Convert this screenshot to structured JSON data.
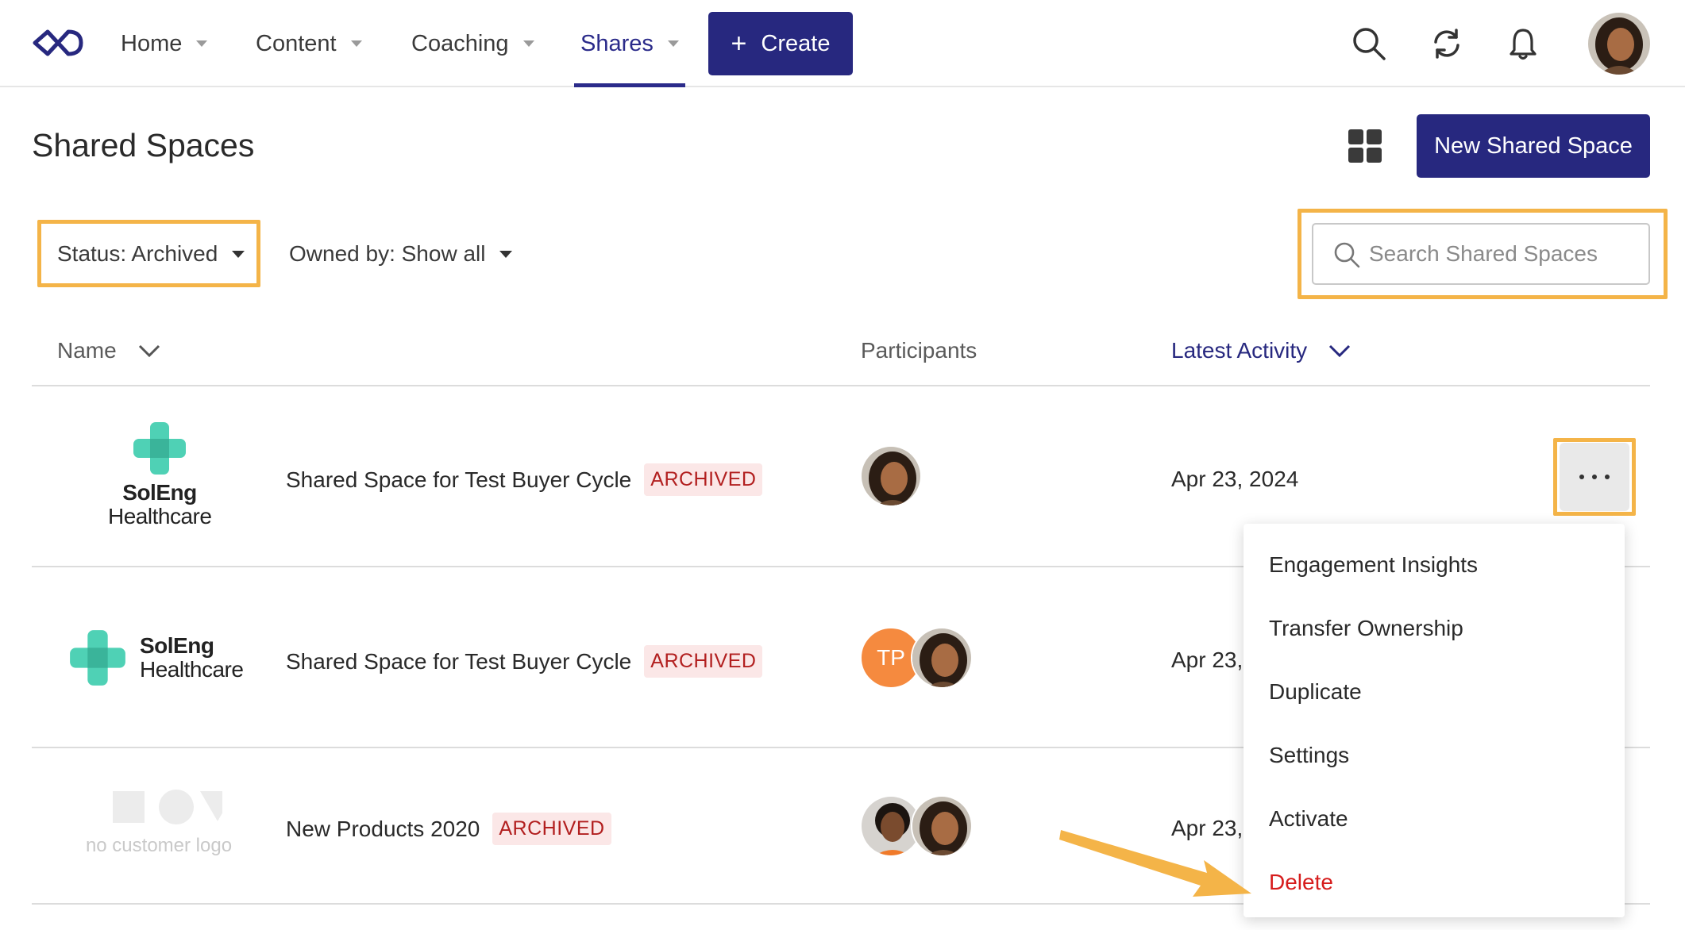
{
  "nav": {
    "items": [
      {
        "label": "Home"
      },
      {
        "label": "Content"
      },
      {
        "label": "Coaching"
      },
      {
        "label": "Shares"
      }
    ],
    "active": "Shares",
    "create_label": "Create",
    "accent": "#27287f"
  },
  "header": {
    "title": "Shared Spaces",
    "new_button": "New Shared Space"
  },
  "filters": {
    "status": "Status: Archived",
    "owned_by": "Owned by: Show all",
    "search_placeholder": "Search Shared Spaces"
  },
  "table": {
    "columns": {
      "name": "Name",
      "participants": "Participants",
      "latest_activity": "Latest Activity"
    },
    "rows": [
      {
        "logo_line1": "SolEng",
        "logo_line2": "Healthcare",
        "name": "Shared Space for Test Buyer Cycle",
        "badge": "ARCHIVED",
        "date": "Apr 23, 2024"
      },
      {
        "logo_line1": "SolEng",
        "logo_line2": "Healthcare",
        "name": "Shared Space for Test Buyer Cycle",
        "badge": "ARCHIVED",
        "participant_initials": "TP",
        "date": "Apr 23,"
      },
      {
        "logo_placeholder": "no customer logo",
        "name": "New Products 2020",
        "badge": "ARCHIVED",
        "date": "Apr 23,"
      }
    ]
  },
  "menu": {
    "items": [
      {
        "label": "Engagement Insights"
      },
      {
        "label": "Transfer Ownership"
      },
      {
        "label": "Duplicate"
      },
      {
        "label": "Settings"
      },
      {
        "label": "Activate"
      },
      {
        "label": "Delete"
      }
    ]
  },
  "colors": {
    "highlight": "#f4b448",
    "badge_text": "#b21f1f",
    "badge_bg": "#fbe7e7",
    "danger": "#d61c1c",
    "logo_teal": "#4fd1b5"
  }
}
